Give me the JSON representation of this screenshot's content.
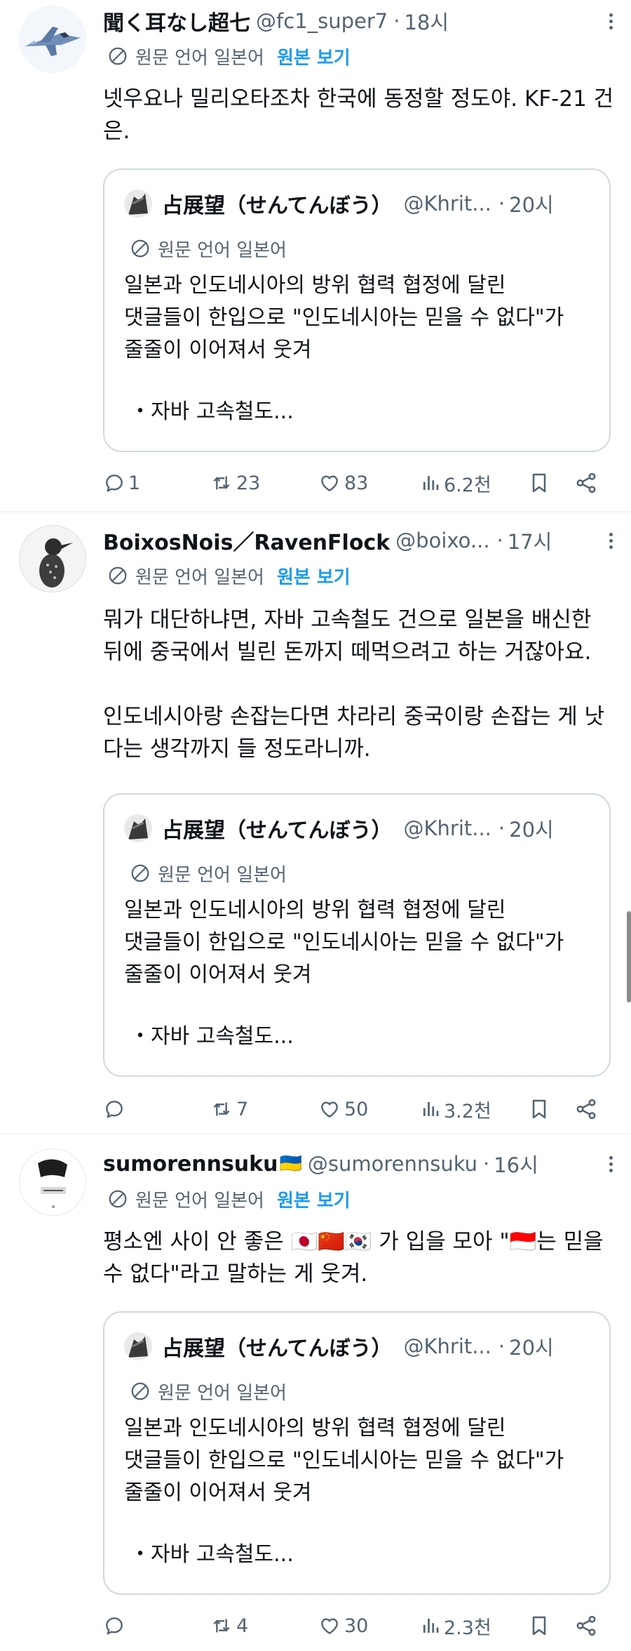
{
  "tweets": [
    {
      "name": "聞く耳なし超七",
      "handle": "@fc1_super7",
      "time": "18시",
      "translation_label": "원문 언어 일본어",
      "translation_action": "원본 보기",
      "body": [
        "넷우요나 밀리오타조차 한국에 동정할 정도야. KF-21 건은."
      ],
      "quote": {
        "name": "占展望（せんてんぼう）",
        "handle": "@Khrit...",
        "time": "20시",
        "translation_label": "원문 언어 일본어",
        "lines": [
          "일본과 인도네시아의 방위 협력 협정에 달린",
          "댓글들이 한입으로 \"인도네시아는 믿을 수 없다\"가",
          "줄줄이 이어져서 웃겨"
        ],
        "bullet": "・자바 고속철도..."
      },
      "stats": {
        "replies": "1",
        "reposts": "23",
        "likes": "83",
        "views": "6.2천"
      }
    },
    {
      "name": "BoixosNois／RavenFlock",
      "handle": "@boixo...",
      "time": "17시",
      "translation_label": "원문 언어 일본어",
      "translation_action": "원본 보기",
      "body": [
        "뭐가 대단하냐면, 자바 고속철도 건으로 일본을 배신한 뒤에 중국에서 빌린 돈까지 떼먹으려고 하는 거잖아요.",
        "인도네시아랑 손잡는다면 차라리 중국이랑 손잡는 게 낫다는 생각까지 들 정도라니까."
      ],
      "quote": {
        "name": "占展望（せんてんぼう）",
        "handle": "@Khrit...",
        "time": "20시",
        "translation_label": "원문 언어 일본어",
        "lines": [
          "일본과 인도네시아의 방위 협력 협정에 달린",
          "댓글들이 한입으로 \"인도네시아는 믿을 수 없다\"가",
          "줄줄이 이어져서 웃겨"
        ],
        "bullet": "・자바 고속철도..."
      },
      "stats": {
        "replies": "",
        "reposts": "7",
        "likes": "50",
        "views": "3.2천"
      }
    },
    {
      "name": "sumorennsuku",
      "name_flag": "🇺🇦",
      "handle": "@sumorennsuku",
      "time": "16시",
      "translation_label": "원문 언어 일본어",
      "translation_action": "원본 보기",
      "body_parts": {
        "before": "평소엔 사이 안 좋은 ",
        "flags": "🇯🇵🇨🇳🇰🇷",
        "middle": " 가 입을 모아 \"",
        "flag2": "🇮🇩",
        "after": "는 믿을 수 없다\"라고 말하는 게 웃겨."
      },
      "quote": {
        "name": "占展望（せんてんぼう）",
        "handle": "@Khrit...",
        "time": "20시",
        "translation_label": "원문 언어 일본어",
        "lines": [
          "일본과 인도네시아의 방위 협력 협정에 달린",
          "댓글들이 한입으로 \"인도네시아는 믿을 수 없다\"가",
          "줄줄이 이어져서 웃겨"
        ],
        "bullet": "・자바 고속철도..."
      },
      "stats": {
        "replies": "",
        "reposts": "4",
        "likes": "30",
        "views": "2.3천"
      }
    }
  ],
  "separator": "·",
  "icons": [
    "translate-icon",
    "more-icon",
    "reply-icon",
    "repost-icon",
    "like-icon",
    "views-icon",
    "bookmark-icon",
    "share-icon"
  ],
  "colors": {
    "text": "#0f1419",
    "secondary": "#536471",
    "link": "#1d9bf0",
    "border": "#cfd9de"
  }
}
